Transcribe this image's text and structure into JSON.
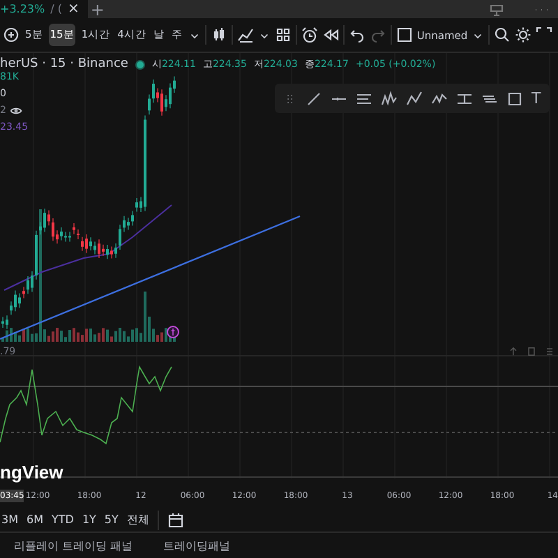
{
  "tab": {
    "change": "+3.23%",
    "rest": "/ (",
    "close": "×",
    "new": "+"
  },
  "toolbar": {
    "intervals": [
      {
        "label": "5분",
        "selected": false
      },
      {
        "label": "15분",
        "selected": true
      },
      {
        "label": "1시간",
        "selected": false
      },
      {
        "label": "4시간",
        "selected": false
      },
      {
        "label": "날",
        "selected": false
      },
      {
        "label": "주",
        "selected": false
      }
    ],
    "layout_name": "Unnamed"
  },
  "legend": {
    "symbol": "herUS · 15 · Binance",
    "ohlc": [
      {
        "label": "시",
        "value": "224.11"
      },
      {
        "label": "고",
        "value": "224.35"
      },
      {
        "label": "저",
        "value": "224.03"
      },
      {
        "label": "종",
        "value": "224.17"
      }
    ],
    "change": "+0.05 (+0.02%)"
  },
  "indicators": [
    {
      "text": "81K",
      "color": "#22ab94"
    },
    {
      "text": "0",
      "color": "#d1d4dc"
    },
    {
      "text": "2",
      "color": "#787b86"
    },
    {
      "text": "23.45",
      "color": "#7e57c2"
    }
  ],
  "drawing_tools": {
    "text_tool": "T"
  },
  "rsi_value": ".79",
  "logo": "ngView",
  "time_axis": [
    {
      "label": "03:45",
      "highlighted": true
    },
    {
      "label": "12:00",
      "highlighted": false
    },
    {
      "label": "18:00",
      "highlighted": false
    },
    {
      "label": "12",
      "highlighted": false
    },
    {
      "label": "06:00",
      "highlighted": false
    },
    {
      "label": "12:00",
      "highlighted": false
    },
    {
      "label": "18:00",
      "highlighted": false
    },
    {
      "label": "13",
      "highlighted": false
    },
    {
      "label": "06:00",
      "highlighted": false
    },
    {
      "label": "12:00",
      "highlighted": false
    },
    {
      "label": "18:00",
      "highlighted": false
    },
    {
      "label": "14",
      "highlighted": false
    }
  ],
  "ranges": [
    "3M",
    "6M",
    "YTD",
    "1Y",
    "5Y",
    "전체"
  ],
  "bottom_tabs": [
    "리플레이 트레이딩 패널",
    "트레이딩패널"
  ]
}
